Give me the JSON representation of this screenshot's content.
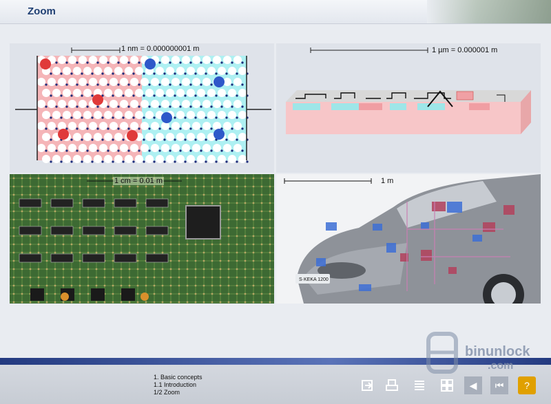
{
  "header": {
    "title": "Zoom"
  },
  "panels": {
    "nm": {
      "scale_label": "1 nm = 0.000000001 m"
    },
    "um": {
      "scale_label": "1 µm = 0.000001 m"
    },
    "cm": {
      "scale_label": "1 cm = 0.01 m"
    },
    "m": {
      "scale_label": "1 m"
    }
  },
  "footer": {
    "breadcrumb": [
      "1. Basic concepts",
      "1.1 Introduction",
      "1/2 Zoom"
    ]
  },
  "nav_buttons": [
    {
      "icon": "exit-icon"
    },
    {
      "icon": "print-icon"
    },
    {
      "icon": "contents-icon"
    },
    {
      "icon": "index-icon"
    },
    {
      "icon": "back-icon",
      "glyph": "◀"
    },
    {
      "icon": "first-icon",
      "glyph": "⏮"
    },
    {
      "icon": "help-icon",
      "glyph": "?"
    }
  ],
  "watermark": {
    "line1": "binunlock",
    "line2": ".com"
  },
  "car": {
    "plate": "S·KEKA 1200"
  },
  "colors": {
    "title": "#1f3f73",
    "bluebar": "#233a80",
    "nav_orange": "#e0a000"
  }
}
